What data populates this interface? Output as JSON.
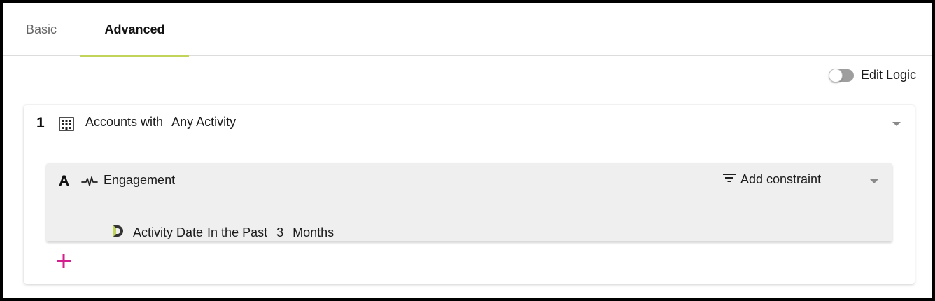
{
  "tabs": [
    {
      "label": "Basic",
      "active": false
    },
    {
      "label": "Advanced",
      "active": true
    }
  ],
  "edit_logic": {
    "label": "Edit Logic",
    "enabled": false
  },
  "rule": {
    "index": "1",
    "icon": "building-icon",
    "title_parts": [
      "Accounts with",
      "Any Activity"
    ],
    "sub": {
      "letter": "A",
      "icon": "pulse-icon",
      "title": "Engagement",
      "add_constraint_label": "Add constraint",
      "constraint": {
        "icon": "date-icon",
        "field": "Activity Date",
        "operator": "In the Past",
        "value": "3",
        "unit": "Months"
      }
    }
  },
  "colors": {
    "tab_underline": "#c3d45a",
    "add_button": "#d4208f",
    "date_icon_accent": "#c3d45a"
  }
}
